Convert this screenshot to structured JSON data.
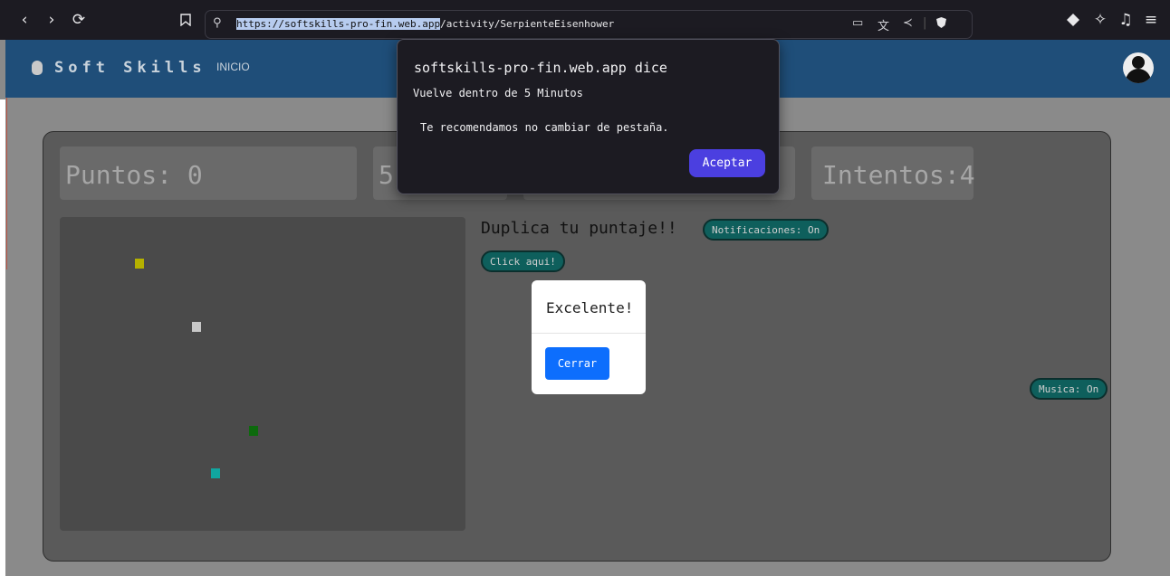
{
  "browser": {
    "url_host": "https://softskills-pro-fin.web.app",
    "url_path": "/activity/SerpienteEisenhower"
  },
  "navbar": {
    "brand": "Soft Skills",
    "nav_link": "INICIO"
  },
  "stats": {
    "points": "Puntos: 0",
    "hidden_stat_visible": "5",
    "attempts": "Intentos:4"
  },
  "promo": {
    "title": "Duplica tu puntaje!!",
    "notifications": "Notificaciones: On",
    "click_here": "Click aqui!",
    "music": "Musica: On"
  },
  "board": {
    "food_colors": [
      "#b5b100",
      "#c8c8c8",
      "#0d6a0d",
      "#11a6a0"
    ]
  },
  "modal": {
    "title": "Excelente!",
    "close_label": "Cerrar"
  },
  "alert": {
    "title": "softskills-pro-fin.web.app dice",
    "line1": "Vuelve dentro de 5 Minutos",
    "line2": "Te recomendamos no cambiar de pestaña.",
    "accept_label": "Aceptar"
  }
}
